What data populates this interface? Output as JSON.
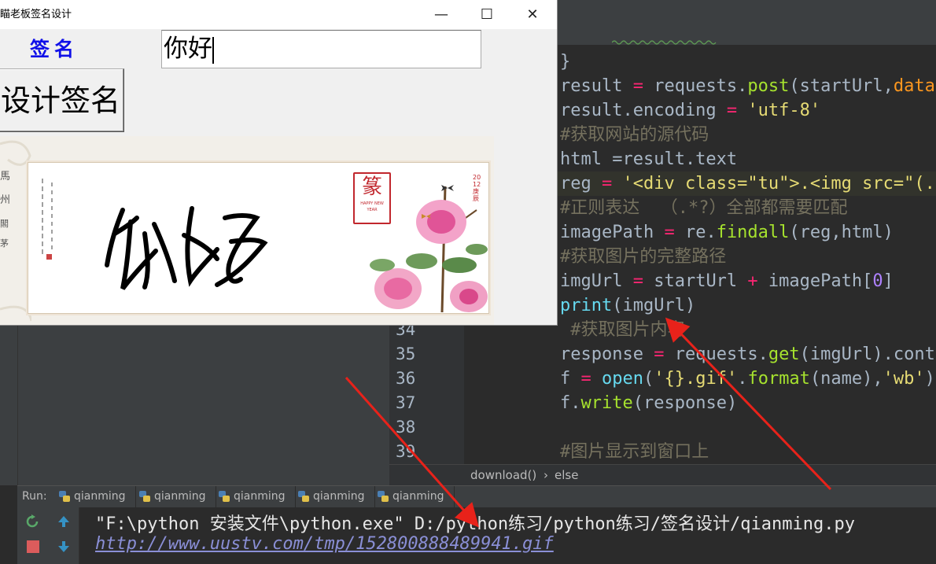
{
  "window": {
    "title": "瞄老板签名设计",
    "minimize_glyph": "—",
    "maximize_glyph": "☐",
    "close_glyph": "✕"
  },
  "form": {
    "signature_label": "签名",
    "signature_value": "你好",
    "design_button": "设计签名"
  },
  "signature_image": {
    "handwriting": "你好",
    "stamp_char": "篆",
    "stamp_text": "HAPPY NEW YEAR",
    "side_text": "2012庚辰"
  },
  "editor": {
    "highlight_line_color": "#32332c",
    "code_lines": [
      {
        "num": "",
        "text": "}"
      },
      {
        "num": "",
        "text": "result = requests.post(startUrl,data"
      },
      {
        "num": "",
        "text": "result.encoding = 'utf-8'"
      },
      {
        "num": "",
        "text": "#获取网站的源代码"
      },
      {
        "num": "",
        "text": "html =result.text"
      },
      {
        "num": "",
        "text": "reg = '<div class=\"tu\">.<img src=\"(."
      },
      {
        "num": "",
        "text": "#正则表达  （.*?）全部都需要匹配"
      },
      {
        "num": "",
        "text": "imagePath = re.findall(reg,html)"
      },
      {
        "num": "",
        "text": "#获取图片的完整路径"
      },
      {
        "num": "",
        "text": "imgUrl = startUrl + imagePath[0]"
      },
      {
        "num": "",
        "text": "print(imgUrl)"
      },
      {
        "num": "34",
        "text": " #获取图片内容"
      },
      {
        "num": "35",
        "text": "response = requests.get(imgUrl).cont"
      },
      {
        "num": "36",
        "text": "f = open('{}.gif'.format(name),'wb')"
      },
      {
        "num": "37",
        "text": "f.write(response)"
      },
      {
        "num": "38",
        "text": ""
      },
      {
        "num": "39",
        "text": "#图片显示到窗口上"
      }
    ],
    "breadcrumb": [
      "download()",
      "›",
      "else"
    ]
  },
  "run_panel": {
    "label": "Run:",
    "tabs": [
      "qianming",
      "qianming",
      "qianming",
      "qianming",
      "qianming"
    ],
    "console": [
      "\"F:\\python 安装文件\\python.exe\" D:/python练习/python练习/签名设计/qianming.py",
      "http://www.uustv.com/tmp/152800888489941.gif"
    ]
  },
  "colors": {
    "keyword": "#cc7832",
    "string": "#6a8759",
    "comment": "#808080",
    "function": "#a6e22e",
    "operator": "#f92672",
    "number": "#ae81ff",
    "builtin": "#66d9ef",
    "signature_label": "#1010e8",
    "arrow": "#e8221a"
  }
}
